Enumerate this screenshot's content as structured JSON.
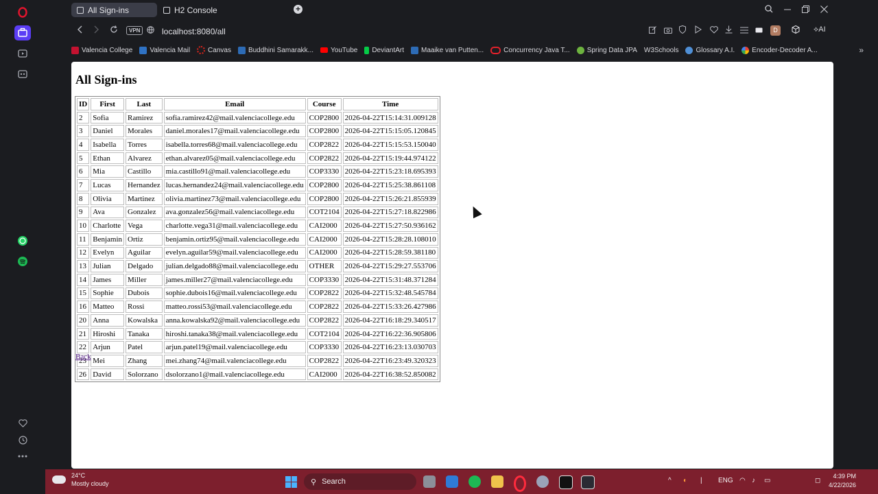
{
  "browser": {
    "tabs": [
      {
        "label": "All Sign-ins",
        "active": true
      },
      {
        "label": "H2 Console",
        "active": false
      }
    ],
    "vpn_label": "VPN",
    "url": "localhost:8080/all",
    "profile_initial": "D",
    "ai_label": "AI"
  },
  "bookmarks": [
    {
      "label": "Valencia College",
      "color": "#c41230"
    },
    {
      "label": "Valencia Mail",
      "color": "#2f72c4"
    },
    {
      "label": "Canvas",
      "color": "#e1261c"
    },
    {
      "label": "Buddhini Samarakk...",
      "color": "#2d6bb5"
    },
    {
      "label": "YouTube",
      "color": "#ff0000"
    },
    {
      "label": "DeviantArt",
      "color": "#05cc47"
    },
    {
      "label": "Maaike van Putten...",
      "color": "#2d6bb5"
    },
    {
      "label": "Concurrency Java T...",
      "color": "#e5212b"
    },
    {
      "label": "Spring Data JPA",
      "color": "#6db33f"
    },
    {
      "label": "W3Schools",
      "color": "#04aa6d"
    },
    {
      "label": "Glossary A.I.",
      "color": "#4f8fd6"
    },
    {
      "label": "Encoder-Decoder A...",
      "color": "#ea4335"
    }
  ],
  "page": {
    "heading": "All Sign-ins",
    "back_label": "Back",
    "columns": [
      "ID",
      "First",
      "Last",
      "Email",
      "Course",
      "Time"
    ],
    "rows": [
      [
        "2",
        "Sofia",
        "Ramirez",
        "sofia.ramirez42@mail.valenciacollege.edu",
        "COP2800",
        "2026-04-22T15:14:31.009128"
      ],
      [
        "3",
        "Daniel",
        "Morales",
        "daniel.morales17@mail.valenciacollege.edu",
        "COP2800",
        "2026-04-22T15:15:05.120845"
      ],
      [
        "4",
        "Isabella",
        "Torres",
        "isabella.torres68@mail.valenciacollege.edu",
        "COP2822",
        "2026-04-22T15:15:53.150040"
      ],
      [
        "5",
        "Ethan",
        "Alvarez",
        "ethan.alvarez05@mail.valenciacollege.edu",
        "COP2822",
        "2026-04-22T15:19:44.974122"
      ],
      [
        "6",
        "Mia",
        "Castillo",
        "mia.castillo91@mail.valenciacollege.edu",
        "COP3330",
        "2026-04-22T15:23:18.695393"
      ],
      [
        "7",
        "Lucas",
        "Hernandez",
        "lucas.hernandez24@mail.valenciacollege.edu",
        "COP2800",
        "2026-04-22T15:25:38.861108"
      ],
      [
        "8",
        "Olivia",
        "Martinez",
        "olivia.martinez73@mail.valenciacollege.edu",
        "COP2800",
        "2026-04-22T15:26:21.855939"
      ],
      [
        "9",
        "Ava",
        "Gonzalez",
        "ava.gonzalez56@mail.valenciacollege.edu",
        "COT2104",
        "2026-04-22T15:27:18.822986"
      ],
      [
        "10",
        "Charlotte",
        "Vega",
        "charlotte.vega31@mail.valenciacollege.edu",
        "CAI2000",
        "2026-04-22T15:27:50.936162"
      ],
      [
        "11",
        "Benjamin",
        "Ortiz",
        "benjamin.ortiz95@mail.valenciacollege.edu",
        "CAI2000",
        "2026-04-22T15:28:28.108010"
      ],
      [
        "12",
        "Evelyn",
        "Aguilar",
        "evelyn.aguilar59@mail.valenciacollege.edu",
        "CAI2000",
        "2026-04-22T15:28:59.381180"
      ],
      [
        "13",
        "Julian",
        "Delgado",
        "julian.delgado88@mail.valenciacollege.edu",
        "OTHER",
        "2026-04-22T15:29:27.553706"
      ],
      [
        "14",
        "James",
        "Miller",
        "james.miller27@mail.valenciacollege.edu",
        "COP3330",
        "2026-04-22T15:31:48.371284"
      ],
      [
        "15",
        "Sophie",
        "Dubois",
        "sophie.dubois16@mail.valenciacollege.edu",
        "COP2822",
        "2026-04-22T15:32:48.545784"
      ],
      [
        "16",
        "Matteo",
        "Rossi",
        "matteo.rossi53@mail.valenciacollege.edu",
        "COP2822",
        "2026-04-22T15:33:26.427986"
      ],
      [
        "20",
        "Anna",
        "Kowalska",
        "anna.kowalska92@mail.valenciacollege.edu",
        "COP2822",
        "2026-04-22T16:18:29.340517"
      ],
      [
        "21",
        "Hiroshi",
        "Tanaka",
        "hiroshi.tanaka38@mail.valenciacollege.edu",
        "COT2104",
        "2026-04-22T16:22:36.905806"
      ],
      [
        "22",
        "Arjun",
        "Patel",
        "arjun.patel19@mail.valenciacollege.edu",
        "COP3330",
        "2026-04-22T16:23:13.030703"
      ],
      [
        "23",
        "Mei",
        "Zhang",
        "mei.zhang74@mail.valenciacollege.edu",
        "COP2822",
        "2026-04-22T16:23:49.320323"
      ],
      [
        "26",
        "David",
        "Solorzano",
        "dsolorzano1@mail.valenciacollege.edu",
        "CAI2000",
        "2026-04-22T16:38:52.850082"
      ]
    ]
  },
  "taskbar": {
    "temperature": "24°C",
    "weather": "Mostly cloudy",
    "search_label": "Search",
    "language": "ENG",
    "time": "4:39 PM",
    "date": "4/22/2026"
  },
  "colors": {
    "taskbar_bg": "#7d1f2d",
    "browser_bg": "#1b1c20",
    "active_tab": "#3b3d48",
    "link_visited": "#551a8b"
  }
}
